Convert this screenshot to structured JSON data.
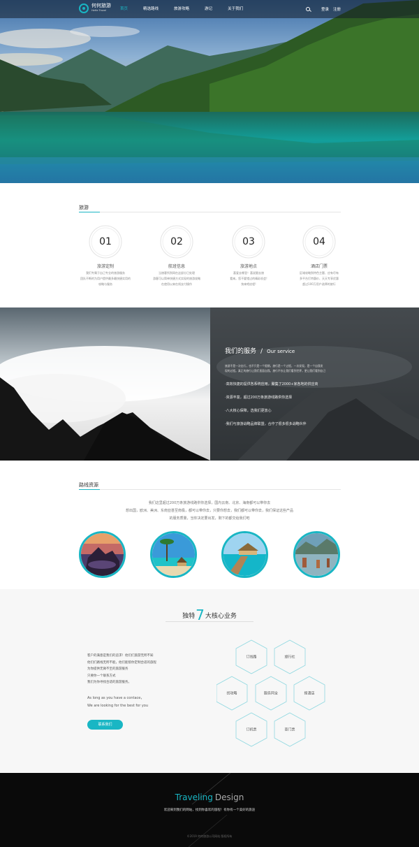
{
  "nav": {
    "logo_cn": "何何旅游",
    "logo_en": "HeHe Travel",
    "links": [
      "首页",
      "精选路线",
      "旅游攻略",
      "游记",
      "关于我们"
    ],
    "login": "登录",
    "register": "注册"
  },
  "travel": {
    "title": "旅游",
    "items": [
      {
        "num": "01",
        "title": "旅游定制",
        "desc": [
          "我们专属于自己专业的旅游服务",
          "团队不断的为用户提供最多最快捷实用的",
          "攻略与服务"
        ]
      },
      {
        "num": "02",
        "title": "航班信息",
        "desc": [
          "当旅客所到网在这部分已处理",
          "游客可以简单快捷方式实现的旅游攻略",
          "在使用以来在线支付操作"
        ]
      },
      {
        "num": "03",
        "title": "旅游地点",
        "desc": [
          "喜爱去哪里！喜说跟去旅",
          "看来。您不要错过的精彩机会!",
          "快来吧启程!"
        ]
      },
      {
        "num": "04",
        "title": "酒店门票",
        "desc": [
          "区域攻略到特色主题、应有尽有",
          "多平台打特惠价、天天专享优惠",
          "超过100万用户选择的旅行"
        ]
      }
    ]
  },
  "our_service": {
    "title_cn": "我们的服务",
    "slash": "/",
    "title_en": "Our service",
    "intro": [
      "旅游不是一次出行，也不只是一个假期。旅行是一个过程，一次发现，是一个自我发",
      "现的过程。真正的旅行让我们直面自我。旅行不仅让我们看到世界，更让我们看到自己"
    ],
    "bullets": [
      "·高效快捷的提供各系统应用，聚集了2000+家各地的供应商",
      "·资源丰富，超过200万条旅游线路供你选择",
      "·八大核心保障，选我们更放心",
      "·我们与旅游战略品牌联盟，合作了很多很多战略伙伴"
    ]
  },
  "routes": {
    "title": "路线资源",
    "intro": [
      "我们这里超过200万条旅游线路供你选择，国内云南、北京、海南都可以带你去",
      "想出国，欧洲、美洲、东南亚甚至南极，都可以带你去，只要你想去，我们都可以带你去，我们保证这些产品",
      "的服务质量，当你决定要出发，剩下的都交给我们吧"
    ]
  },
  "core": {
    "title_a": "独特",
    "title_num": "7",
    "title_b": "大核心业务",
    "lines": [
      "客户的满意是我们的追求！他们们旅游无所不知",
      "他们们路线无所不能，他们能帮你定制合适的旅程",
      "为你提供无微不至的旅游服务",
      "只要你一个联系方式",
      "我们为你寻找合适的旅游服务。"
    ],
    "en_lines": [
      "As long as you have a contace，",
      "We are looking for the best for you"
    ],
    "button": "联系我们",
    "hexes": [
      "订线路",
      "旅行社",
      "找攻略",
      "服务同全",
      "搜酒店",
      "订机票",
      "查门票"
    ]
  },
  "footer": {
    "brand_a": "Traveling",
    "brand_b": "Design",
    "tagline": "欢迎来到我们的网站，找到你喜欢的旅程！有你有一个美好的旅途",
    "copyright": "©2019 何何旅游公司网站 版权所有"
  }
}
